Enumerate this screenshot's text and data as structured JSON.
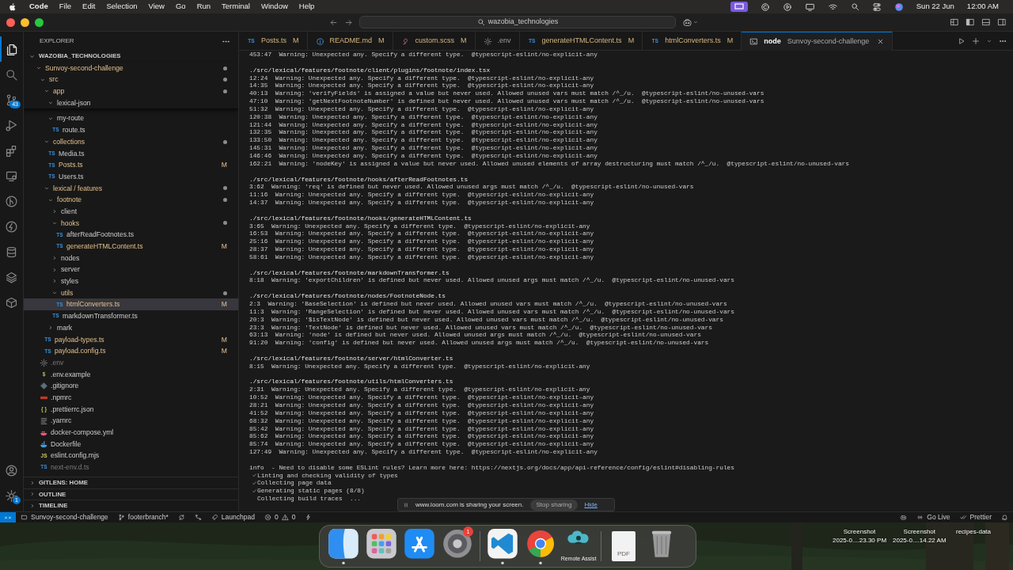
{
  "menubar": {
    "app": "Code",
    "menus": [
      "File",
      "Edit",
      "Selection",
      "View",
      "Go",
      "Run",
      "Terminal",
      "Window",
      "Help"
    ],
    "date": "Sun 22 Jun",
    "time": "12:00 AM"
  },
  "titlebar": {
    "search": "wazobia_technologies"
  },
  "activity_bar": {
    "items": [
      {
        "kind": "files",
        "selected": true
      },
      {
        "kind": "search",
        "selected": false
      },
      {
        "kind": "scm",
        "selected": false,
        "badge": "43"
      },
      {
        "kind": "run",
        "selected": false
      },
      {
        "kind": "extensions",
        "selected": false
      },
      {
        "kind": "remote",
        "selected": false
      },
      {
        "kind": "gitlens",
        "selected": false
      },
      {
        "kind": "bolt",
        "selected": false
      },
      {
        "kind": "database",
        "selected": false
      },
      {
        "kind": "layers",
        "selected": false
      },
      {
        "kind": "box",
        "selected": false
      }
    ],
    "bottom": [
      {
        "kind": "account"
      },
      {
        "kind": "settings",
        "badge": "1"
      }
    ]
  },
  "sidebar": {
    "title": "EXPLORER",
    "root": {
      "label": "WAZOBIA_TECHNOLOGIES",
      "expanded": true,
      "children": [
        {
          "kind": "folder",
          "label": "Sunvoy-second-challenge",
          "expanded": true,
          "modified": true,
          "selected": false,
          "children": [
            {
              "kind": "folder",
              "label": "src",
              "expanded": true,
              "modified": true,
              "selected": false,
              "children": [
                {
                  "kind": "folder",
                  "label": "app",
                  "expanded": true,
                  "modified": true,
                  "selected": false,
                  "children": [
                    {
                      "kind": "folder",
                      "label": "lexical-json",
                      "expanded": true,
                      "modified": false,
                      "selected": false
                    },
                    {
                      "kind": "folder",
                      "label": "my-route",
                      "expanded": true,
                      "modified": false,
                      "selected": false,
                      "children": [
                        {
                          "kind": "ts",
                          "glyph": "TS",
                          "label": "route.ts",
                          "modified": false,
                          "ignored": false,
                          "selected": false
                        }
                      ]
                    }
                  ]
                },
                {
                  "kind": "folder",
                  "label": "collections",
                  "expanded": true,
                  "modified": true,
                  "selected": false,
                  "children": [
                    {
                      "kind": "ts",
                      "glyph": "TS",
                      "label": "Media.ts",
                      "modified": false,
                      "ignored": false,
                      "selected": false
                    },
                    {
                      "kind": "ts",
                      "glyph": "TS",
                      "label": "Posts.ts",
                      "modified": true,
                      "ignored": false,
                      "badge": "M",
                      "selected": false
                    },
                    {
                      "kind": "ts",
                      "glyph": "TS",
                      "label": "Users.ts",
                      "modified": false,
                      "ignored": false,
                      "selected": false
                    }
                  ]
                },
                {
                  "kind": "folder",
                  "label": "lexical / features",
                  "expanded": true,
                  "modified": true,
                  "selected": false,
                  "children": [
                    {
                      "kind": "folder",
                      "label": "footnote",
                      "expanded": true,
                      "modified": true,
                      "selected": false,
                      "children": [
                        {
                          "kind": "folder",
                          "label": "client",
                          "expanded": false,
                          "modified": false,
                          "selected": false
                        },
                        {
                          "kind": "folder",
                          "label": "hooks",
                          "expanded": true,
                          "modified": true,
                          "selected": false,
                          "children": [
                            {
                              "kind": "ts",
                              "glyph": "TS",
                              "label": "afterReadFootnotes.ts",
                              "modified": false,
                              "ignored": false,
                              "selected": false
                            },
                            {
                              "kind": "ts",
                              "glyph": "TS",
                              "label": "generateHTMLContent.ts",
                              "modified": true,
                              "ignored": false,
                              "badge": "M",
                              "selected": false
                            }
                          ]
                        },
                        {
                          "kind": "folder",
                          "label": "nodes",
                          "expanded": false,
                          "modified": false,
                          "selected": false
                        },
                        {
                          "kind": "folder",
                          "label": "server",
                          "expanded": false,
                          "modified": false,
                          "selected": false
                        },
                        {
                          "kind": "folder",
                          "label": "styles",
                          "expanded": false,
                          "modified": false,
                          "selected": false
                        },
                        {
                          "kind": "folder",
                          "label": "utils",
                          "expanded": true,
                          "modified": true,
                          "selected": false,
                          "children": [
                            {
                              "kind": "ts",
                              "glyph": "TS",
                              "label": "htmlConverters.ts",
                              "modified": true,
                              "ignored": false,
                              "badge": "M",
                              "selected": true
                            }
                          ]
                        },
                        {
                          "kind": "ts",
                          "glyph": "TS",
                          "label": "markdownTransformer.ts",
                          "modified": false,
                          "ignored": false,
                          "selected": false
                        }
                      ]
                    },
                    {
                      "kind": "folder",
                      "label": "mark",
                      "expanded": false,
                      "modified": false,
                      "selected": false
                    }
                  ]
                },
                {
                  "kind": "ts",
                  "glyph": "TS",
                  "label": "payload-types.ts",
                  "modified": true,
                  "ignored": false,
                  "badge": "M",
                  "selected": false
                },
                {
                  "kind": "ts",
                  "glyph": "TS",
                  "label": "payload.config.ts",
                  "modified": true,
                  "ignored": false,
                  "badge": "M",
                  "selected": false
                }
              ]
            },
            {
              "kind": "gear",
              "label": ".env",
              "modified": false,
              "ignored": true,
              "selected": false
            },
            {
              "kind": "shell",
              "glyph": "$",
              "label": ".env.example",
              "modified": false,
              "ignored": false,
              "selected": false
            },
            {
              "kind": "git",
              "label": ".gitignore",
              "modified": false,
              "ignored": false,
              "selected": false
            },
            {
              "kind": "npmrc",
              "label": ".npmrc",
              "modified": false,
              "ignored": false,
              "selected": false
            },
            {
              "kind": "json",
              "glyph": "{ }",
              "label": ".prettierrc.json",
              "modified": false,
              "ignored": false,
              "selected": false
            },
            {
              "kind": "lines",
              "label": ".yarnrc",
              "modified": false,
              "ignored": false,
              "selected": false
            },
            {
              "kind": "compose",
              "label": "docker-compose.yml",
              "modified": false,
              "ignored": false,
              "selected": false
            },
            {
              "kind": "docker",
              "label": "Dockerfile",
              "modified": false,
              "ignored": false,
              "selected": false
            },
            {
              "kind": "js",
              "glyph": "JS",
              "label": "eslint.config.mjs",
              "modified": false,
              "ignored": false,
              "selected": false
            },
            {
              "kind": "ts",
              "glyph": "TS",
              "label": "next-env.d.ts",
              "modified": false,
              "ignored": true,
              "selected": false
            }
          ]
        }
      ]
    },
    "sections": [
      {
        "label": "GITLENS: HOME",
        "expanded": false
      },
      {
        "label": "OUTLINE",
        "expanded": false
      },
      {
        "label": "TIMELINE",
        "expanded": false
      }
    ]
  },
  "tabs": [
    {
      "kind": "ts",
      "glyph": "TS",
      "label": "Posts.ts",
      "badge": "M",
      "selected": false
    },
    {
      "kind": "info",
      "label": "README.md",
      "badge": "M",
      "selected": false
    },
    {
      "kind": "sass",
      "label": "custom.scss",
      "badge": "M",
      "selected": false
    },
    {
      "kind": "gear",
      "label": ".env",
      "selected": false
    },
    {
      "kind": "ts",
      "glyph": "TS",
      "label": "generateHTMLContent.ts",
      "badge": "M",
      "selected": false
    },
    {
      "kind": "ts",
      "glyph": "TS",
      "label": "htmlConverters.ts",
      "badge": "M",
      "selected": false
    },
    {
      "kind": "terminal",
      "label": "node",
      "description": "Sunvoy-second-challenge",
      "selected": true
    }
  ],
  "terminal": {
    "blocks": [
      {
        "lines": [
          "453:47  Warning: Unexpected any. Specify a different type.  @typescript-eslint/no-explicit-any"
        ]
      },
      {
        "header": "./src/lexical/features/footnote/client/plugins/footnote/index.tsx",
        "lines": [
          "12:24  Warning: Unexpected any. Specify a different type.  @typescript-eslint/no-explicit-any",
          "14:35  Warning: Unexpected any. Specify a different type.  @typescript-eslint/no-explicit-any",
          "40:13  Warning: 'verifyFields' is assigned a value but never used. Allowed unused vars must match /^_/u.  @typescript-eslint/no-unused-vars",
          "47:10  Warning: 'getNextFootnoteNumber' is defined but never used. Allowed unused vars must match /^_/u.  @typescript-eslint/no-unused-vars",
          "51:32  Warning: Unexpected any. Specify a different type.  @typescript-eslint/no-explicit-any",
          "120:38  Warning: Unexpected any. Specify a different type.  @typescript-eslint/no-explicit-any",
          "121:44  Warning: Unexpected any. Specify a different type.  @typescript-eslint/no-explicit-any",
          "132:35  Warning: Unexpected any. Specify a different type.  @typescript-eslint/no-explicit-any",
          "133:50  Warning: Unexpected any. Specify a different type.  @typescript-eslint/no-explicit-any",
          "145:31  Warning: Unexpected any. Specify a different type.  @typescript-eslint/no-explicit-any",
          "146:46  Warning: Unexpected any. Specify a different type.  @typescript-eslint/no-explicit-any",
          "162:21  Warning: 'nodeKey' is assigned a value but never used. Allowed unused elements of array destructuring must match /^_/u.  @typescript-eslint/no-unused-vars"
        ]
      },
      {
        "header": "./src/lexical/features/footnote/hooks/afterReadFootnotes.ts",
        "lines": [
          "3:62  Warning: 'req' is defined but never used. Allowed unused args must match /^_/u.  @typescript-eslint/no-unused-vars",
          "11:16  Warning: Unexpected any. Specify a different type.  @typescript-eslint/no-explicit-any",
          "14:37  Warning: Unexpected any. Specify a different type.  @typescript-eslint/no-explicit-any"
        ]
      },
      {
        "header": "./src/lexical/features/footnote/hooks/generateHTMLContent.ts",
        "lines": [
          "3:65  Warning: Unexpected any. Specify a different type.  @typescript-eslint/no-explicit-any",
          "16:53  Warning: Unexpected any. Specify a different type.  @typescript-eslint/no-explicit-any",
          "25:16  Warning: Unexpected any. Specify a different type.  @typescript-eslint/no-explicit-any",
          "28:37  Warning: Unexpected any. Specify a different type.  @typescript-eslint/no-explicit-any",
          "58:61  Warning: Unexpected any. Specify a different type.  @typescript-eslint/no-explicit-any"
        ]
      },
      {
        "header": "./src/lexical/features/footnote/markdownTransformer.ts",
        "lines": [
          "8:18  Warning: 'exportChildren' is defined but never used. Allowed unused args must match /^_/u.  @typescript-eslint/no-unused-vars"
        ]
      },
      {
        "header": "./src/lexical/features/footnote/nodes/FootnoteNode.ts",
        "lines": [
          "2:3  Warning: 'BaseSelection' is defined but never used. Allowed unused vars must match /^_/u.  @typescript-eslint/no-unused-vars",
          "11:3  Warning: 'RangeSelection' is defined but never used. Allowed unused vars must match /^_/u.  @typescript-eslint/no-unused-vars",
          "20:3  Warning: '$isTextNode' is defined but never used. Allowed unused vars must match /^_/u.  @typescript-eslint/no-unused-vars",
          "23:3  Warning: 'TextNode' is defined but never used. Allowed unused vars must match /^_/u.  @typescript-eslint/no-unused-vars",
          "63:13  Warning: 'node' is defined but never used. Allowed unused args must match /^_/u.  @typescript-eslint/no-unused-vars",
          "91:20  Warning: 'config' is defined but never used. Allowed unused args must match /^_/u.  @typescript-eslint/no-unused-vars"
        ]
      },
      {
        "header": "./src/lexical/features/footnote/server/htmlConverter.ts",
        "lines": [
          "8:15  Warning: Unexpected any. Specify a different type.  @typescript-eslint/no-explicit-any"
        ]
      },
      {
        "header": "./src/lexical/features/footnote/utils/htmlConverters.ts",
        "lines": [
          "2:31  Warning: Unexpected any. Specify a different type.  @typescript-eslint/no-explicit-any",
          "10:52  Warning: Unexpected any. Specify a different type.  @typescript-eslint/no-explicit-any",
          "28:21  Warning: Unexpected any. Specify a different type.  @typescript-eslint/no-explicit-any",
          "41:52  Warning: Unexpected any. Specify a different type.  @typescript-eslint/no-explicit-any",
          "68:32  Warning: Unexpected any. Specify a different type.  @typescript-eslint/no-explicit-any",
          "85:42  Warning: Unexpected any. Specify a different type.  @typescript-eslint/no-explicit-any",
          "85:62  Warning: Unexpected any. Specify a different type.  @typescript-eslint/no-explicit-any",
          "85:74  Warning: Unexpected any. Specify a different type.  @typescript-eslint/no-explicit-any",
          "127:49  Warning: Unexpected any. Specify a different type.  @typescript-eslint/no-explicit-any"
        ]
      }
    ],
    "info": "info  - Need to disable some ESLint rules? Learn more here: https://nextjs.org/docs/app/api-reference/config/eslint#disabling-rules",
    "steps": [
      {
        "text": "Linting and checking validity of types",
        "done": true
      },
      {
        "text": "Collecting page data",
        "done": true
      },
      {
        "text": "Generating static pages (8/8)",
        "done": true
      },
      {
        "text": "Collecting build traces  ...",
        "done": false
      }
    ]
  },
  "loom": {
    "message": "www.loom.com is sharing your screen.",
    "stop": "Stop sharing",
    "hide": "Hide"
  },
  "status_bar": {
    "left": [
      {
        "kind": "remote"
      },
      {
        "kind": "folder",
        "text": "Sunvoy-second-challenge"
      },
      {
        "kind": "branch",
        "text": "footerbranch*"
      },
      {
        "kind": "sync"
      },
      {
        "kind": "graph"
      },
      {
        "kind": "rocket",
        "text": "Launchpad"
      },
      {
        "kind": "problems",
        "errors": "0",
        "warnings": "0"
      },
      {
        "kind": "bolt"
      }
    ],
    "right": [
      {
        "kind": "copilot"
      },
      {
        "kind": "broadcast",
        "text": "Go Live"
      },
      {
        "kind": "checks",
        "text": "Prettier"
      },
      {
        "kind": "bell"
      }
    ]
  },
  "desktop": {
    "files": [
      {
        "name": "Screenshot",
        "detail": "2025-0....23.30 PM"
      },
      {
        "name": "Screenshot",
        "detail": "2025-0....14.22 AM"
      },
      {
        "name": "recipes-data"
      }
    ],
    "dock": [
      [
        {
          "kind": "finder",
          "running": true
        },
        {
          "kind": "launchpad",
          "running": false
        },
        {
          "kind": "appstore",
          "running": false
        },
        {
          "kind": "settings",
          "running": false,
          "badge": "1"
        }
      ],
      [
        {
          "kind": "vscode",
          "running": true
        },
        {
          "kind": "chrome",
          "running": true
        },
        {
          "kind": "remote-assist",
          "running": false,
          "label": "Remote Assist"
        }
      ],
      [
        {
          "kind": "pdf",
          "running": false,
          "label": "PDF"
        },
        {
          "kind": "trash",
          "running": false
        }
      ]
    ]
  }
}
